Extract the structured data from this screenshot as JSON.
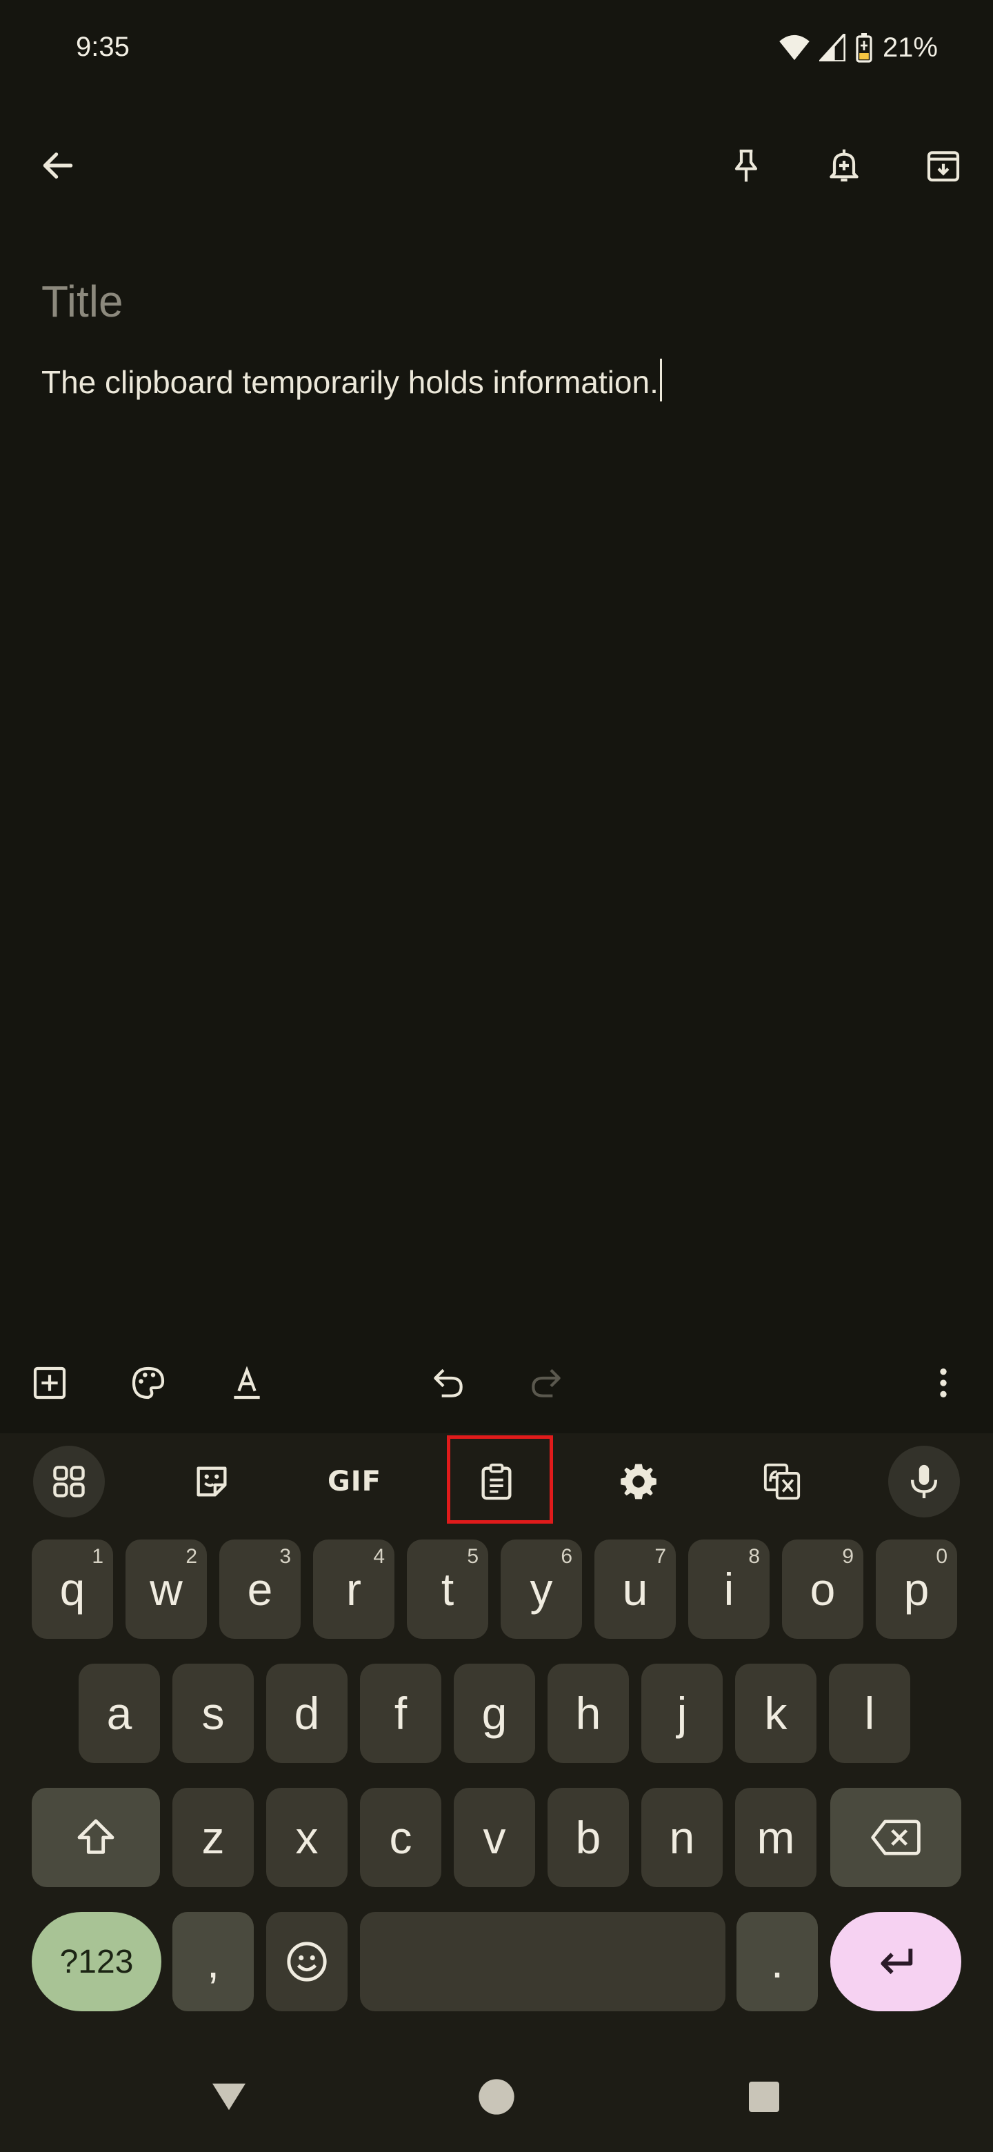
{
  "status_bar": {
    "time": "9:35",
    "battery": "21%"
  },
  "note": {
    "title_placeholder": "Title",
    "body_text": "The clipboard temporarily holds information."
  },
  "keyboard": {
    "gif_label": "GIF",
    "row1": [
      {
        "key": "q",
        "hint": "1"
      },
      {
        "key": "w",
        "hint": "2"
      },
      {
        "key": "e",
        "hint": "3"
      },
      {
        "key": "r",
        "hint": "4"
      },
      {
        "key": "t",
        "hint": "5"
      },
      {
        "key": "y",
        "hint": "6"
      },
      {
        "key": "u",
        "hint": "7"
      },
      {
        "key": "i",
        "hint": "8"
      },
      {
        "key": "o",
        "hint": "9"
      },
      {
        "key": "p",
        "hint": "0"
      }
    ],
    "row2": [
      "a",
      "s",
      "d",
      "f",
      "g",
      "h",
      "j",
      "k",
      "l"
    ],
    "row3": [
      "z",
      "x",
      "c",
      "v",
      "b",
      "n",
      "m"
    ],
    "sym_label": "?123",
    "comma": ",",
    "period": "."
  },
  "colors": {
    "background": "#15150f",
    "keyboard_bg": "#1d1c15",
    "key_bg": "#3b392f",
    "sym_key": "#a8c395",
    "enter_key": "#f6d2f2",
    "highlight": "#e01b1b"
  },
  "icons": [
    "back-arrow-icon",
    "pin-icon",
    "reminder-bell-icon",
    "archive-icon",
    "add-box-icon",
    "palette-icon",
    "text-format-icon",
    "undo-icon",
    "redo-icon",
    "more-vert-icon",
    "apps-grid-icon",
    "sticker-icon",
    "gif-icon",
    "clipboard-icon",
    "settings-gear-icon",
    "translate-icon",
    "microphone-icon"
  ]
}
